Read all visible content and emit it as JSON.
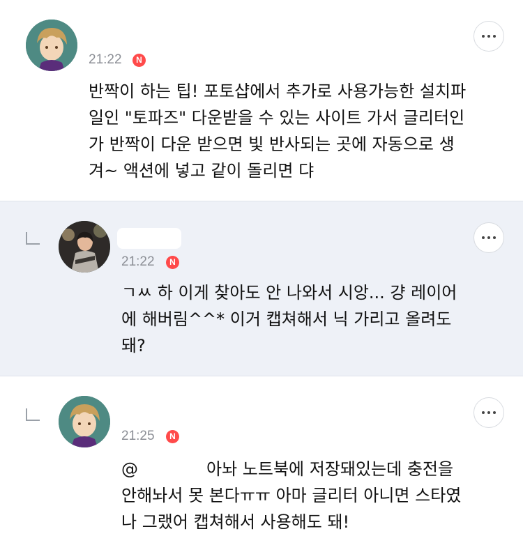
{
  "comments": [
    {
      "time": "21:22",
      "badge": "N",
      "lines": [
        "반짝이 하는 팁! 포토샵에서 추가로 사용가능한 설치파",
        "일인 \"토파즈\" 다운받을 수 있는 사이트 가서 글리터인",
        "가 반짝이 다운 받으면 빛 반사되는 곳에 자동으로 생",
        "겨~ 액션에 넣고 같이 돌리면 댜"
      ]
    },
    {
      "time": "21:22",
      "badge": "N",
      "lines": [
        "ㄱㅆ 하 이게 찾아도 안 나와서 시앙... 걍 레이어",
        "에 해버림^^* 이거 캡쳐해서 닉 가리고 올려도",
        "돼?"
      ]
    },
    {
      "time": "21:25",
      "badge": "N",
      "mention": "@",
      "lines": [
        "아놔 노트북에 저장돼있는데 충전을",
        "안해놔서 못 본다ㅠㅠ 아마 글리터 아니면 스타였",
        "나 그랬어 캡쳐해서 사용해도 돼!"
      ]
    }
  ]
}
